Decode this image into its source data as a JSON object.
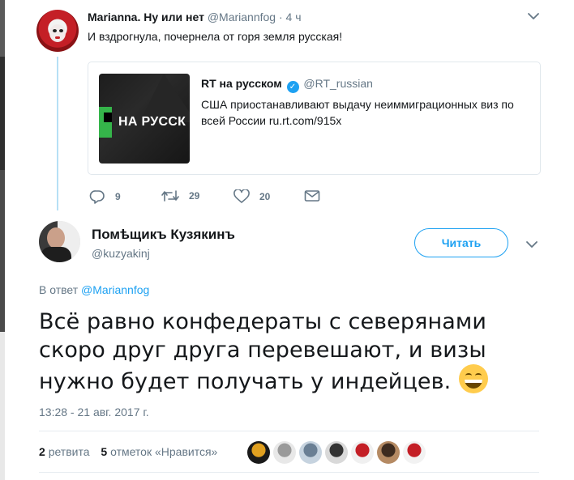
{
  "top_tweet": {
    "name": "Marianna. Ну или нет",
    "handle": "@Mariannfog",
    "time": "· 4 ч",
    "text": "И вздрогнула, почернела от горя земля русская!",
    "quoted": {
      "image_label": "НА РУССК",
      "name": "RT на русском",
      "verified_mark": "✓",
      "handle": "@RT_russian",
      "text": "США приостанавливают выдачу неиммиграционных виз по всей России ru.rt.com/915x"
    },
    "actions": {
      "replies": "9",
      "retweets": "29",
      "likes": "20"
    }
  },
  "main_tweet": {
    "name": "Помѣщикъ Кузякинъ",
    "handle": "@kuzyakinj",
    "follow_label": "Читать",
    "reply_prefix": "В ответ",
    "reply_handle": "@Mariannfog",
    "text": "Всё равно конфедераты с северянами скоро друг друга перевешают, и визы нужно будет получать у индейцев.",
    "timestamp": "13:28 - 21 авг. 2017 г.",
    "stats": {
      "retweets_count": "2",
      "retweets_label": "ретвита",
      "likes_count": "5",
      "likes_label": "отметок «Нравится»"
    }
  },
  "colors": {
    "accent": "#1da1f2",
    "secondary_text": "#657786",
    "border": "#e1e8ed",
    "thread_line": "#b6e0f5"
  },
  "icons": [
    "reply-icon",
    "retweet-icon",
    "like-icon",
    "message-icon",
    "chevron-down-icon",
    "verified-icon",
    "grinning-emoji-icon"
  ],
  "likers": [
    {
      "colors": [
        "#1a1a1a",
        "#e0a020"
      ]
    },
    {
      "colors": [
        "#e8e8e8",
        "#9a9a9a"
      ]
    },
    {
      "colors": [
        "#c6d3df",
        "#6a7f94"
      ]
    },
    {
      "colors": [
        "#d9d9d9",
        "#333333"
      ]
    },
    {
      "colors": [
        "#f0f0f0",
        "#c41f26"
      ]
    },
    {
      "colors": [
        "#b58a63",
        "#3d2b1f"
      ]
    },
    {
      "colors": [
        "#f2f2f2",
        "#c41f26"
      ]
    }
  ]
}
